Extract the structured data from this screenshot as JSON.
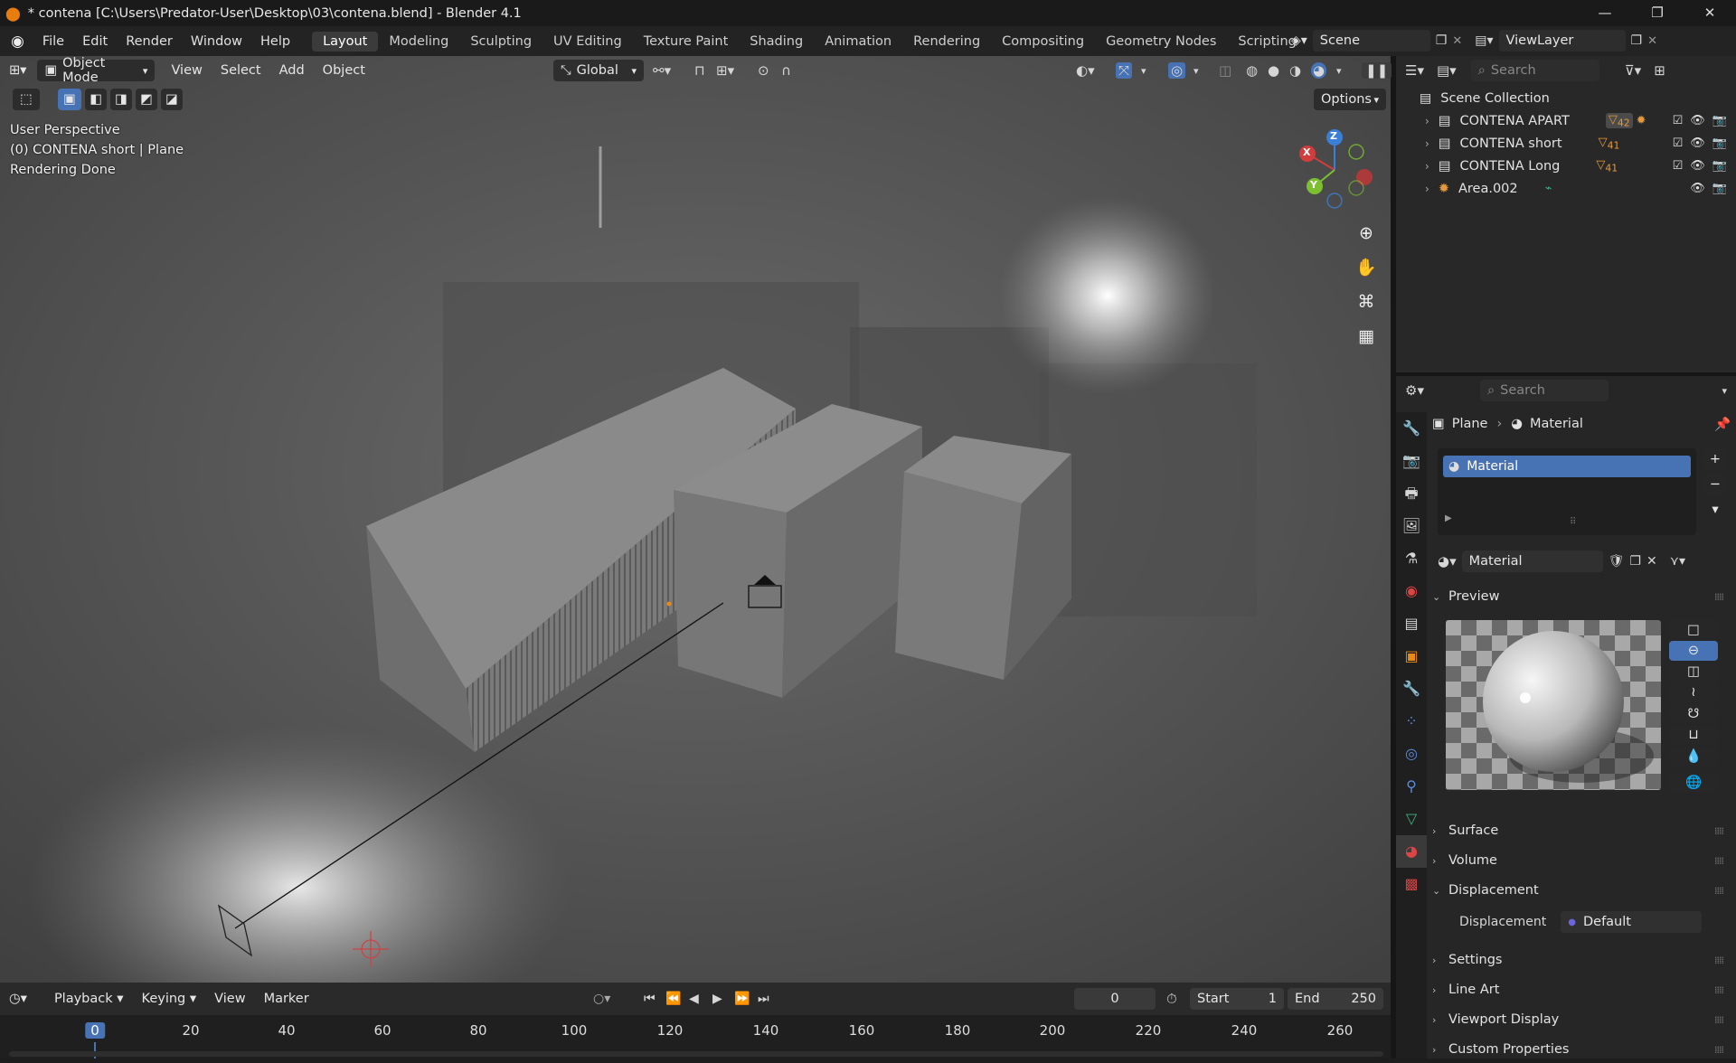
{
  "window": {
    "title": "* contena [C:\\Users\\Predator-User\\Desktop\\03\\contena.blend] - Blender 4.1",
    "minimize": "—",
    "maximize": "❐",
    "close": "✕"
  },
  "menu": [
    "File",
    "Edit",
    "Render",
    "Window",
    "Help"
  ],
  "workspaces": [
    "Layout",
    "Modeling",
    "Sculpting",
    "UV Editing",
    "Texture Paint",
    "Shading",
    "Animation",
    "Rendering",
    "Compositing",
    "Geometry Nodes",
    "Scripting"
  ],
  "workspace_add": "+",
  "scene": "Scene",
  "view_layer": "ViewLayer",
  "viewport": {
    "mode": "Object Mode",
    "menus": [
      "View",
      "Select",
      "Add",
      "Object"
    ],
    "transform": "Global",
    "options": "Options",
    "overlay": [
      "User Perspective",
      "(0) CONTENA short | Plane",
      "Rendering Done"
    ],
    "gizmo": {
      "x": "X",
      "y": "Y",
      "z": "Z"
    }
  },
  "timeline": {
    "menus": [
      "Playback",
      "Keying",
      "View",
      "Marker"
    ],
    "current_frame": "0",
    "start_label": "Start",
    "start": "1",
    "end_label": "End",
    "end": "250",
    "ticks": [
      "0",
      "20",
      "40",
      "60",
      "80",
      "100",
      "120",
      "140",
      "160",
      "180",
      "200",
      "220",
      "240",
      "260"
    ]
  },
  "outliner": {
    "search_placeholder": "Search",
    "root": "Scene Collection",
    "items": [
      {
        "name": "CONTENA APART",
        "badge": "42"
      },
      {
        "name": "CONTENA short",
        "badge": "41"
      },
      {
        "name": "CONTENA Long",
        "badge": "41"
      },
      {
        "name": "Area.002",
        "badge": ""
      }
    ]
  },
  "properties": {
    "search_placeholder": "Search",
    "breadcrumb": [
      "Plane",
      "Material"
    ],
    "slot": "Material",
    "material_name": "Material",
    "panels": {
      "preview": "Preview",
      "surface": "Surface",
      "volume": "Volume",
      "displacement": "Displacement",
      "settings": "Settings",
      "line_art": "Line Art",
      "viewport_display": "Viewport Display",
      "custom_properties": "Custom Properties"
    },
    "displacement_label": "Displacement",
    "displacement_value": "Default"
  },
  "colors": {
    "accent": "#4772b3",
    "active_ws": "#3b3b3b",
    "x_axis": "#d23c3c",
    "y_axis": "#7cbf2f",
    "z_axis": "#3a7ed6"
  }
}
